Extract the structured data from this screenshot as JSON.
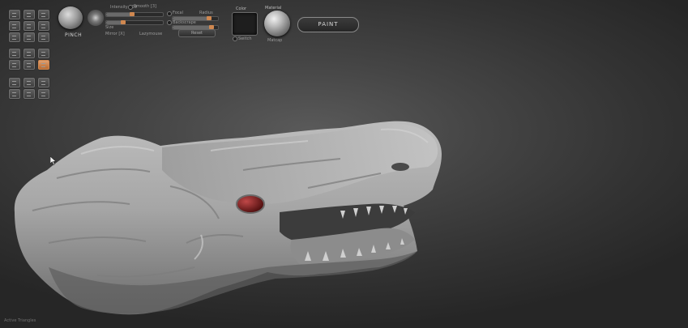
{
  "brush": {
    "name": "PINCH",
    "icon": "pinch-brush-sphere-icon"
  },
  "brush_settings": {
    "texts": [
      "Intensity 100",
      "Smooth [3]",
      "Focal",
      "Radius",
      "Size",
      "Backscrape",
      "Mirror [X]",
      "Lazymouse"
    ],
    "levels": {
      "intensity": 0.45,
      "size": 0.3,
      "focal": 0.8,
      "lazy": 0.85
    },
    "reset_label": "Reset"
  },
  "color": {
    "label": "Color",
    "swatch_hex": "#1e1e1e",
    "sub_label": "Switch"
  },
  "material": {
    "label": "Material",
    "sub_label": "Matcap",
    "icon": "material-sphere-icon"
  },
  "paint_button": {
    "label": "PAINT"
  },
  "status": {
    "text": "Active Triangles"
  },
  "palette_icons": [
    "move-icon",
    "scale-icon",
    "rotate-icon",
    "draw-icon",
    "edit-icon",
    "mask-icon",
    "smooth-icon",
    "frame-icon",
    "local-icon",
    "persp-icon",
    "floor-icon",
    "xpose-icon",
    "gizmo-icon",
    "rgb-icon",
    "mrgb-icon",
    "zadd-icon",
    "zsub-icon",
    "focal-icon"
  ],
  "colors": {
    "viewport_bg": "#3a3a3a",
    "model": "#a8a8a8",
    "eye": "#8a2020",
    "accent": "#d08850"
  }
}
